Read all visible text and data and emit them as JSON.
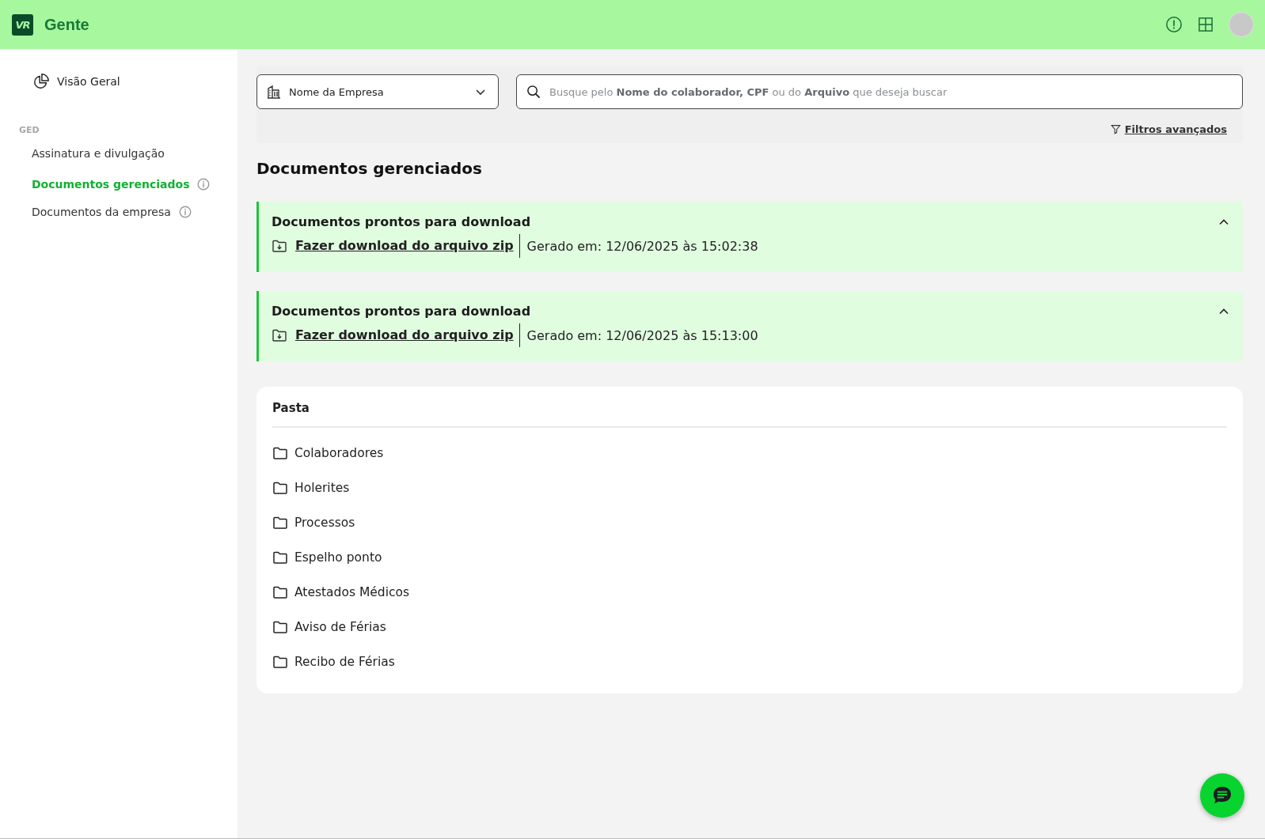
{
  "header": {
    "logo": "VR",
    "title": "Gente"
  },
  "sidebar": {
    "overview": {
      "label": "Visão Geral"
    },
    "section": "GED",
    "items": [
      {
        "label": "Assinatura e divulgação",
        "selected": false,
        "info": false
      },
      {
        "label": "Documentos gerenciados",
        "selected": true,
        "info": true
      },
      {
        "label": "Documentos da empresa",
        "selected": false,
        "info": true
      }
    ]
  },
  "filters": {
    "company_select": {
      "value": "Nome da Empresa"
    },
    "search": {
      "placeholder": "Busque pelo **Nome do colaborador, CPF** ou do **Arquivo** que deseja buscar"
    },
    "advanced_link": "Filtros avançados"
  },
  "page_title": "Documentos gerenciados",
  "downloads": [
    {
      "title": "Documentos prontos para download",
      "link": "Fazer download do arquivo zip",
      "generated": "Gerado em: 12/06/2025 às 15:02:38",
      "expanded": true
    },
    {
      "title": "Documentos prontos para download",
      "link": "Fazer download do arquivo zip",
      "generated": "Gerado em: 12/06/2025 às 15:13:00",
      "expanded": true
    }
  ],
  "folders": {
    "heading": "Pasta",
    "items": [
      "Colaboradores",
      "Holerites",
      "Processos",
      "Espelho ponto",
      "Atestados Médicos",
      "Aviso de Férias",
      "Recibo de Férias"
    ]
  }
}
